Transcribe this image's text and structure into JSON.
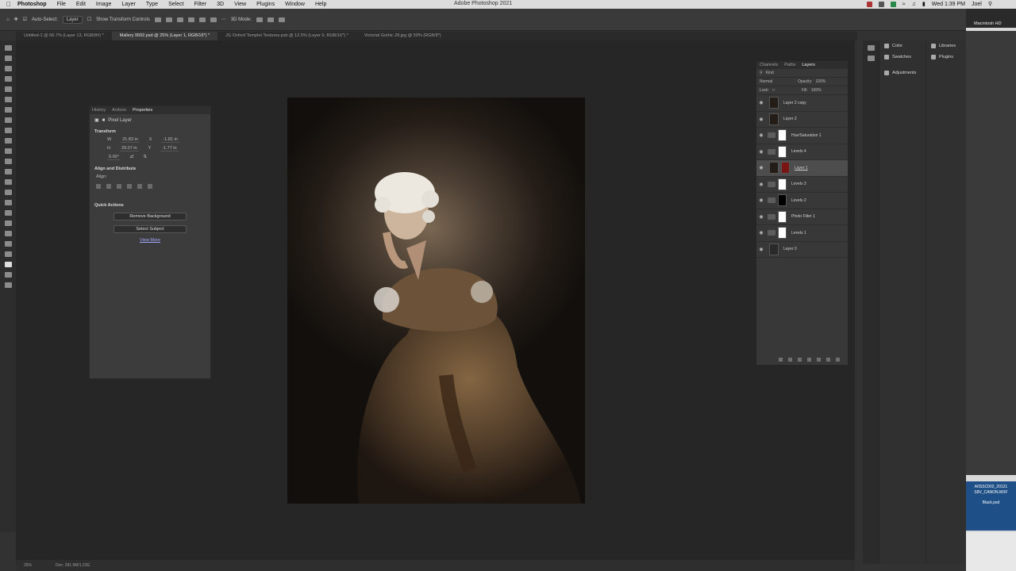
{
  "menubar": {
    "app": "Photoshop",
    "items": [
      "File",
      "Edit",
      "Image",
      "Layer",
      "Type",
      "Select",
      "Filter",
      "3D",
      "View",
      "Plugins",
      "Window",
      "Help"
    ],
    "window_title": "Adobe Photoshop 2021",
    "clock": "Wed 1:39 PM",
    "user": "Joel"
  },
  "options_bar": {
    "auto_select_label": "Auto-Select:",
    "auto_select_value": "Layer",
    "show_transform": "Show Transform Controls",
    "mode_3d": "3D Mode:"
  },
  "tabs": [
    {
      "label": "Untitled-1 @ 66.7% (Layer 13, RGB/8#) *"
    },
    {
      "label": "Mallery 9592.psd @ 25% (Layer 1, RGB/16*) *"
    },
    {
      "label": "JG Oxford Templet Textures.psb @ 12.5% (Layer 0, RGB/16*) *"
    },
    {
      "label": "Victorial Gothic 28.jpg @ 50% (RGB/8*)"
    }
  ],
  "properties": {
    "tabs": [
      "History",
      "Actions",
      "Properties"
    ],
    "type_label": "Pixel Layer",
    "transform_title": "Transform",
    "w_label": "W",
    "w_value": "21.83 in",
    "x_label": "X",
    "x_value": "-1.81 in",
    "h_label": "H",
    "h_value": "29.07 in",
    "y_label": "Y",
    "y_value": "-1.77 in",
    "angle_value": "0.00°",
    "align_title": "Align and Distribute",
    "align_label": "Align:",
    "quick_title": "Quick Actions",
    "remove_bg": "Remove Background",
    "select_subject": "Select Subject",
    "view_more": "View More"
  },
  "layers_panel": {
    "tabs": [
      "Channels",
      "Paths",
      "Layers"
    ],
    "filter_label": "Kind",
    "blend_mode": "Normal",
    "opacity_label": "Opacity:",
    "opacity_value": "100%",
    "lock_label": "Lock:",
    "fill_label": "Fill:",
    "fill_value": "100%",
    "layers": [
      {
        "name": "Layer 2 copy"
      },
      {
        "name": "Layer 2"
      },
      {
        "name": "Hue/Saturation 1"
      },
      {
        "name": "Levels 4"
      },
      {
        "name": "Layer 1"
      },
      {
        "name": "Levels 3"
      },
      {
        "name": "Levels 2"
      },
      {
        "name": "Photo Filter 1"
      },
      {
        "name": "Levels 1"
      },
      {
        "name": "Layer 0"
      }
    ]
  },
  "dock": {
    "color": "Color",
    "swatches": "Swatches",
    "adjustments": "Adjustments",
    "libraries": "Libraries",
    "plugins": "Plugins"
  },
  "statusbar": {
    "zoom": "25%",
    "doc": "Doc: 281.9M/1.23G"
  },
  "finder": {
    "drive": "Macintosh HD",
    "file1": "A0SSC002_20121 S8V_CANON.MXF",
    "file2": "Black.psd"
  }
}
